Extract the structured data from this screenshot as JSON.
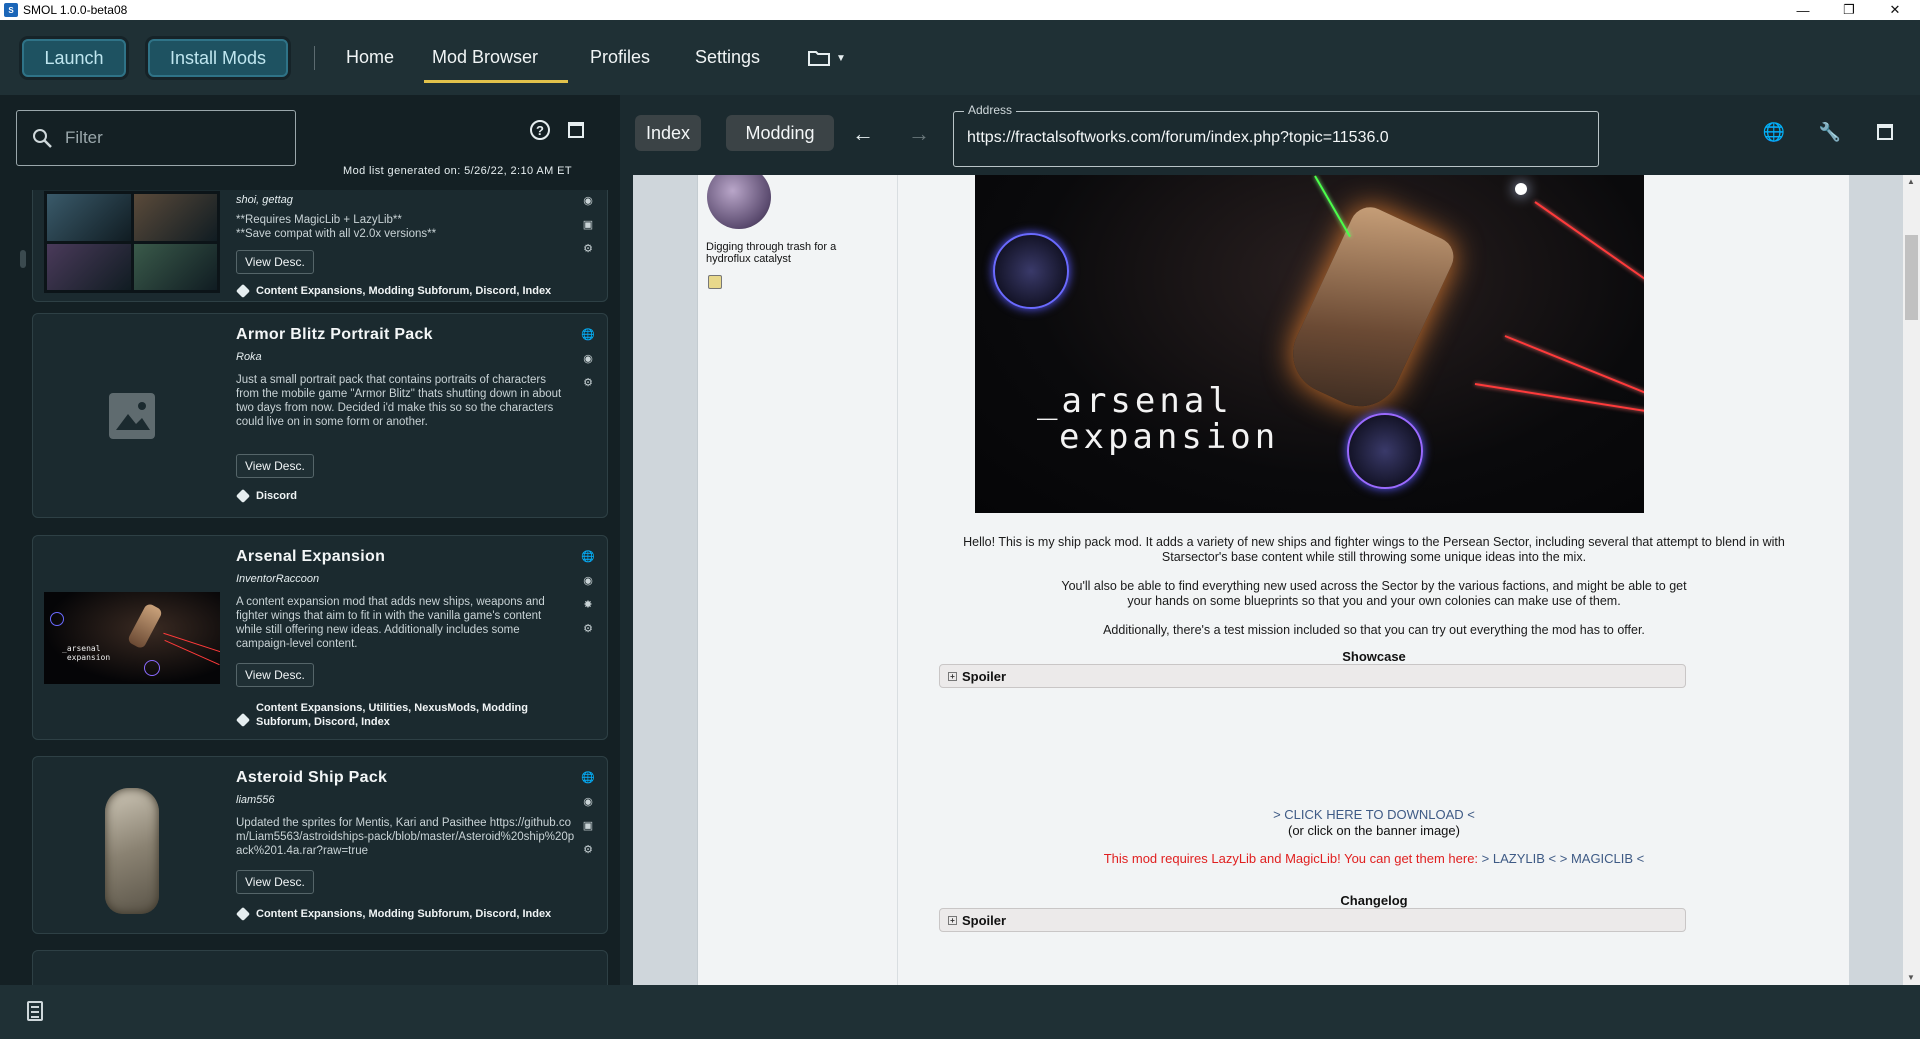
{
  "window": {
    "title": "SMOL 1.0.0-beta08",
    "app_icon_text": "S"
  },
  "topnav": {
    "launch": "Launch",
    "install_mods": "Install Mods",
    "links": [
      "Home",
      "Mod Browser",
      "Profiles",
      "Settings"
    ],
    "active": "Mod Browser"
  },
  "left": {
    "filter_placeholder": "Filter",
    "generated_text": "Mod list generated on: 5/26/22, 2:10 AM ET",
    "view_desc_label": "View Desc.",
    "mods": [
      {
        "name": "",
        "author": "shoi, gettag",
        "desc": "**Requires MagicLib + LazyLib**\n**Save compat with all v2.0x versions**",
        "tags": "Content Expansions, Modding Subforum, Discord, Index"
      },
      {
        "name": "Armor Blitz Portrait Pack",
        "author": "Roka",
        "desc": "Just a small portrait pack that contains portraits of characters from the mobile game \"Armor Blitz\" thats shutting down in about two days from now. Decided i'd make this so so the characters could live on in some form or another.",
        "tags": "Discord"
      },
      {
        "name": "Arsenal Expansion",
        "author": "InventorRaccoon",
        "desc": "A content expansion mod that adds new ships, weapons and fighter wings that aim to fit in with the vanilla game's content while still offering new ideas. Additionally includes some campaign-level content.",
        "tags": "Content Expansions, Utilities, NexusMods, Modding Subforum, Discord, Index"
      },
      {
        "name": "Asteroid Ship Pack",
        "author": "liam556",
        "desc": "Updated the sprites for Mentis, Kari and Pasithee https://github.com/Liam5563/astroidships-pack/blob/master/Asteroid%20ship%20pack%201.4a.rar?raw=true",
        "tags": "Content Expansions, Modding Subforum, Discord, Index"
      }
    ]
  },
  "browser": {
    "tab_index": "Index",
    "tab_modding": "Modding",
    "address_label": "Address",
    "address_value": "https://fractalsoftworks.com/forum/index.php?topic=11536.0",
    "poster_text": "Digging through trash for a hydroflux catalyst",
    "banner_text_1": "_arsenal",
    "banner_text_2": "expansion",
    "para1": "Hello! This is my ship pack mod. It adds a variety of new ships and fighter wings to the Persean Sector, including several that attempt to blend in with Starsector's base content while still throwing some unique ideas into the mix.",
    "para2": "You'll also be able to find everything new used across the Sector by the various factions, and might be able to get your hands on some blueprints so that you and your own colonies can make use of them.",
    "para3": "Additionally, there's a test mission included so that you can try out everything the mod has to offer.",
    "showcase": "Showcase",
    "spoiler": "Spoiler",
    "download_link": "> CLICK HERE TO DOWNLOAD <",
    "download_note": "(or click on the banner image)",
    "req_text": "This mod requires LazyLib and MagicLib! You can get them here:",
    "lazylib_link": "> LAZYLIB <",
    "magiclib_link": "> MAGICLIB <",
    "changelog": "Changelog"
  },
  "colors": {
    "accent": "#e2c24b",
    "primary_button": "#1e5261",
    "link": "#3e5a85",
    "warning": "#e01f1f"
  }
}
